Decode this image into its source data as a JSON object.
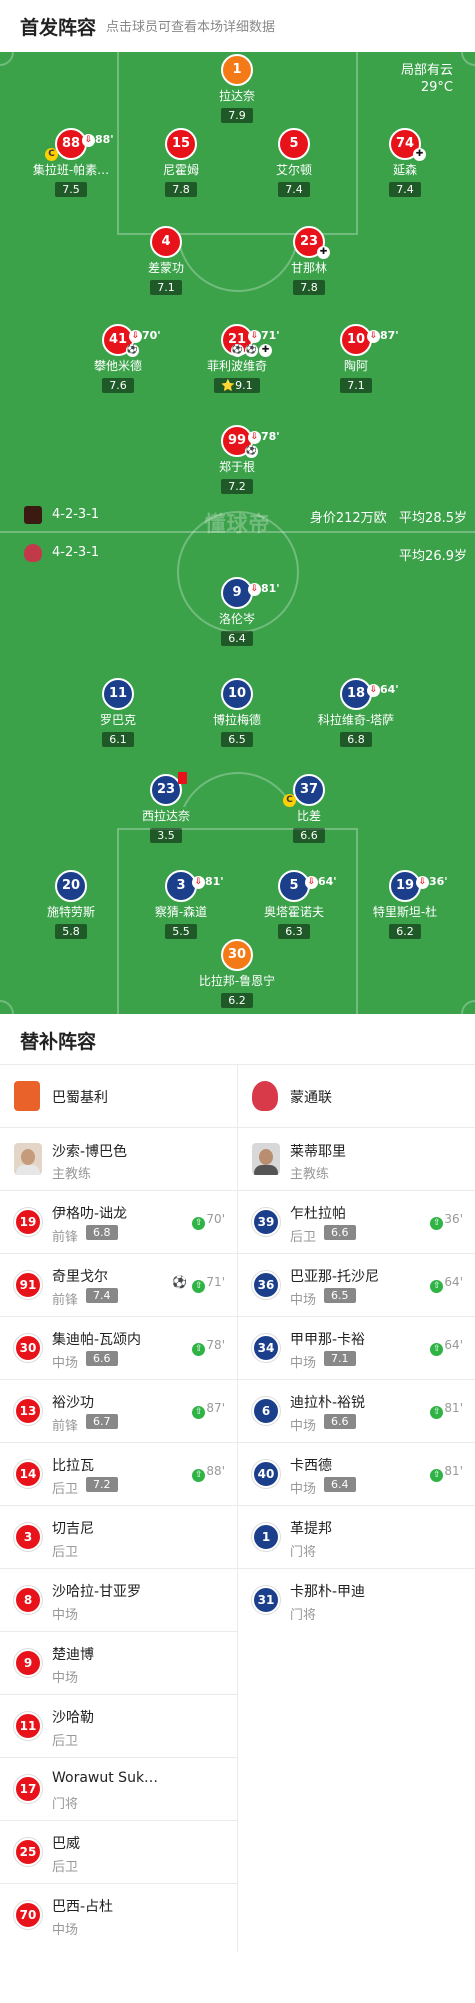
{
  "header": {
    "title": "首发阵容",
    "subtitle": "点击球员可查看本场详细数据"
  },
  "weather": {
    "condition": "局部有云",
    "temp": "29°C"
  },
  "watermark": "懂球帝",
  "home": {
    "formation": "4-2-3-1",
    "value": "身价212万欧",
    "avg_age": "平均28.5岁",
    "color": "#e8131a"
  },
  "away": {
    "formation": "4-2-3-1",
    "avg_age": "平均26.9岁",
    "color": "#1c3f8c"
  },
  "home_players": [
    {
      "num": "1",
      "name": "拉达奈",
      "rating": "7.9"
    },
    {
      "num": "88",
      "name": "集拉班-帕素…",
      "rating": "7.5",
      "sub": "88'"
    },
    {
      "num": "15",
      "name": "尼霍姆",
      "rating": "7.8"
    },
    {
      "num": "5",
      "name": "艾尔顿",
      "rating": "7.4"
    },
    {
      "num": "74",
      "name": "延森",
      "rating": "7.4"
    },
    {
      "num": "4",
      "name": "差蒙功",
      "rating": "7.1"
    },
    {
      "num": "23",
      "name": "甘那林",
      "rating": "7.8"
    },
    {
      "num": "41",
      "name": "攀他米德",
      "rating": "7.6",
      "sub": "70'"
    },
    {
      "num": "21",
      "name": "菲利波维奇",
      "rating": "9.1",
      "sub": "71'"
    },
    {
      "num": "10",
      "name": "陶阿",
      "rating": "7.1",
      "sub": "87'"
    },
    {
      "num": "99",
      "name": "郑于根",
      "rating": "7.2",
      "sub": "78'"
    }
  ],
  "away_players": [
    {
      "num": "9",
      "name": "洛伦岑",
      "rating": "6.4",
      "sub": "81'"
    },
    {
      "num": "11",
      "name": "罗巴克",
      "rating": "6.1"
    },
    {
      "num": "10",
      "name": "博拉梅德",
      "rating": "6.5"
    },
    {
      "num": "18",
      "name": "科拉维奇-塔萨",
      "rating": "6.8",
      "sub": "64'"
    },
    {
      "num": "23",
      "name": "西拉达奈",
      "rating": "3.5"
    },
    {
      "num": "37",
      "name": "比差",
      "rating": "6.6"
    },
    {
      "num": "20",
      "name": "施特劳斯",
      "rating": "5.8"
    },
    {
      "num": "3",
      "name": "察猜-森道",
      "rating": "5.5",
      "sub": "81'"
    },
    {
      "num": "5",
      "name": "奥塔霍诺夫",
      "rating": "6.3",
      "sub": "64'"
    },
    {
      "num": "19",
      "name": "特里斯坦-杜",
      "rating": "6.2",
      "sub": "36'"
    },
    {
      "num": "30",
      "name": "比拉邦-鲁恩宁",
      "rating": "6.2"
    }
  ],
  "subs": {
    "title": "替补阵容",
    "home_team": "巴蜀基利",
    "away_team": "蒙通联",
    "home_coach": {
      "name": "沙索-博巴色",
      "role": "主教练"
    },
    "away_coach": {
      "name": "莱蒂耶里",
      "role": "主教练"
    },
    "home": [
      {
        "num": "19",
        "name": "伊格叻-诎龙",
        "pos": "前锋",
        "rating": "6.8",
        "time": "70'"
      },
      {
        "num": "91",
        "name": "奇里戈尔",
        "pos": "前锋",
        "rating": "7.4",
        "time": "71'"
      },
      {
        "num": "30",
        "name": "集迪帕-瓦颂内",
        "pos": "中场",
        "rating": "6.6",
        "time": "78'"
      },
      {
        "num": "13",
        "name": "裕沙功",
        "pos": "前锋",
        "rating": "6.7",
        "time": "87'"
      },
      {
        "num": "14",
        "name": "比拉瓦",
        "pos": "后卫",
        "rating": "7.2",
        "time": "88'"
      },
      {
        "num": "3",
        "name": "切吉尼",
        "pos": "后卫"
      },
      {
        "num": "8",
        "name": "沙哈拉-甘亚罗",
        "pos": "中场"
      },
      {
        "num": "9",
        "name": "楚迪博",
        "pos": "中场"
      },
      {
        "num": "11",
        "name": "沙哈勒",
        "pos": "后卫"
      },
      {
        "num": "17",
        "name": "Worawut Suk…",
        "pos": "门将"
      },
      {
        "num": "25",
        "name": "巴威",
        "pos": "后卫"
      },
      {
        "num": "70",
        "name": "巴西-占杜",
        "pos": "中场"
      }
    ],
    "away": [
      {
        "num": "39",
        "name": "乍杜拉帕",
        "pos": "后卫",
        "rating": "6.6",
        "time": "36'"
      },
      {
        "num": "36",
        "name": "巴亚那-托沙尼",
        "pos": "中场",
        "rating": "6.5",
        "time": "64'"
      },
      {
        "num": "34",
        "name": "甲甲那-卡裕",
        "pos": "中场",
        "rating": "7.1",
        "time": "64'"
      },
      {
        "num": "6",
        "name": "迪拉朴-裕锐",
        "pos": "中场",
        "rating": "6.6",
        "time": "81'"
      },
      {
        "num": "40",
        "name": "卡西德",
        "pos": "中场",
        "rating": "6.4",
        "time": "81'"
      },
      {
        "num": "1",
        "name": "革提邦",
        "pos": "门将"
      },
      {
        "num": "31",
        "name": "卡那朴-甲迪",
        "pos": "门将"
      }
    ]
  }
}
